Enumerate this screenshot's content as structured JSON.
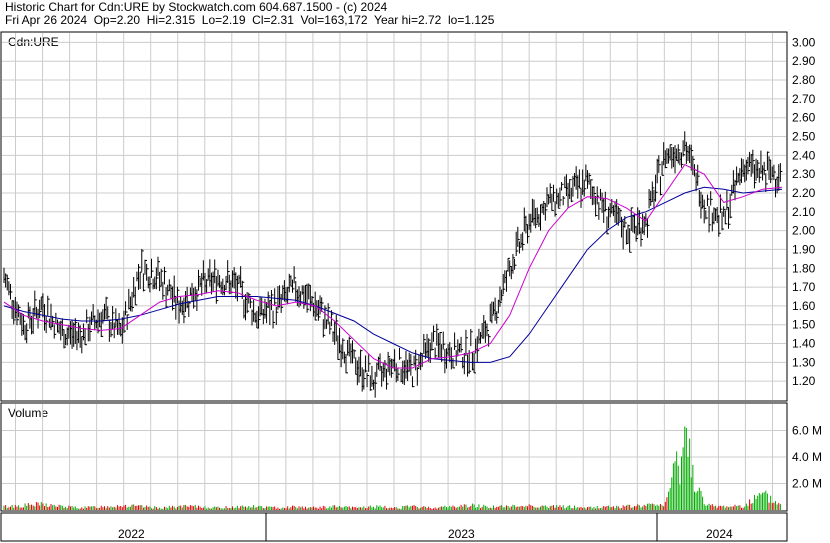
{
  "header": {
    "line1": "Historic Chart for Cdn:URE by Stockwatch.com 604.687.1500 - (c) 2024",
    "line2": "Fri Apr 26 2024  Op=2.20  Hi=2.315  Lo=2.19  Cl=2.31  Vol=163,172  Year hi=2.72  lo=1.125"
  },
  "colors": {
    "price_bar": "#000000",
    "ma_short": "#cc00cc",
    "ma_long": "#000099",
    "volume_up": "#00aa00",
    "volume_down": "#dd0000",
    "grid": "#cccccc"
  },
  "chart_data": [
    {
      "type": "line",
      "panel_label": "Cdn:URE",
      "ylim": [
        1.1,
        3.05
      ],
      "yticks": [
        "3.00",
        "2.90",
        "2.80",
        "2.70",
        "2.60",
        "2.50",
        "2.40",
        "2.30",
        "2.20",
        "2.10",
        "2.00",
        "1.90",
        "1.80",
        "1.70",
        "1.60",
        "1.50",
        "1.40",
        "1.30",
        "1.20"
      ],
      "grid": true,
      "x_month_index": [
        0,
        1,
        2,
        3,
        4,
        5,
        6,
        7,
        8,
        9,
        10,
        11,
        12,
        13,
        14,
        15,
        16,
        17,
        18,
        19,
        20,
        21,
        22,
        23,
        24,
        25,
        26,
        27,
        28
      ],
      "series": [
        {
          "kind": "price",
          "values": [
            1.75,
            1.5,
            1.6,
            1.45,
            1.45,
            1.55,
            1.45,
            1.8,
            1.75,
            1.6,
            1.7,
            1.75,
            1.7,
            1.55,
            1.6,
            1.7,
            1.6,
            1.45,
            1.3,
            1.2,
            1.3,
            1.25,
            1.4,
            1.35,
            1.35,
            1.5,
            1.8,
            2.05,
            2.15,
            2.2,
            2.25,
            2.1,
            2.0,
            2.05,
            2.4,
            2.45,
            2.15,
            2.05,
            2.35,
            2.3,
            2.31
          ]
        },
        {
          "kind": "moving-average-short",
          "values": [
            1.62,
            1.55,
            1.52,
            1.5,
            1.48,
            1.47,
            1.48,
            1.55,
            1.62,
            1.65,
            1.66,
            1.68,
            1.67,
            1.63,
            1.6,
            1.62,
            1.6,
            1.52,
            1.42,
            1.32,
            1.27,
            1.27,
            1.32,
            1.33,
            1.35,
            1.4,
            1.55,
            1.8,
            2.0,
            2.12,
            2.18,
            2.17,
            2.12,
            2.05,
            2.2,
            2.35,
            2.3,
            2.15,
            2.18,
            2.22,
            2.23
          ]
        },
        {
          "kind": "moving-average-long",
          "values": [
            1.6,
            1.57,
            1.55,
            1.53,
            1.52,
            1.52,
            1.53,
            1.55,
            1.58,
            1.61,
            1.63,
            1.65,
            1.65,
            1.65,
            1.64,
            1.63,
            1.6,
            1.56,
            1.52,
            1.45,
            1.4,
            1.35,
            1.32,
            1.31,
            1.3,
            1.3,
            1.33,
            1.45,
            1.6,
            1.75,
            1.9,
            2.0,
            2.07,
            2.1,
            2.15,
            2.2,
            2.23,
            2.22,
            2.2,
            2.21,
            2.22
          ]
        }
      ]
    },
    {
      "type": "bar",
      "panel_label": "Volume",
      "ylim": [
        0,
        8.0
      ],
      "yticks": [
        "6.0 M",
        "4.0 M",
        "2.0 M"
      ],
      "grid": true,
      "values": [
        0.3,
        0.4,
        0.5,
        0.3,
        0.2,
        0.3,
        0.4,
        0.3,
        0.2,
        0.3,
        0.3,
        0.2,
        0.3,
        0.3,
        0.2,
        0.3,
        0.2,
        0.3,
        0.2,
        0.3,
        0.2,
        0.3,
        0.2,
        0.3,
        0.4,
        0.3,
        0.3,
        0.4,
        0.3,
        0.3,
        0.2,
        0.3,
        0.3,
        0.4,
        0.5,
        6.3,
        0.4,
        0.3,
        0.4,
        1.3,
        0.4
      ]
    }
  ],
  "x_axis": {
    "labels": [
      "2022",
      "2023",
      "2024"
    ]
  }
}
